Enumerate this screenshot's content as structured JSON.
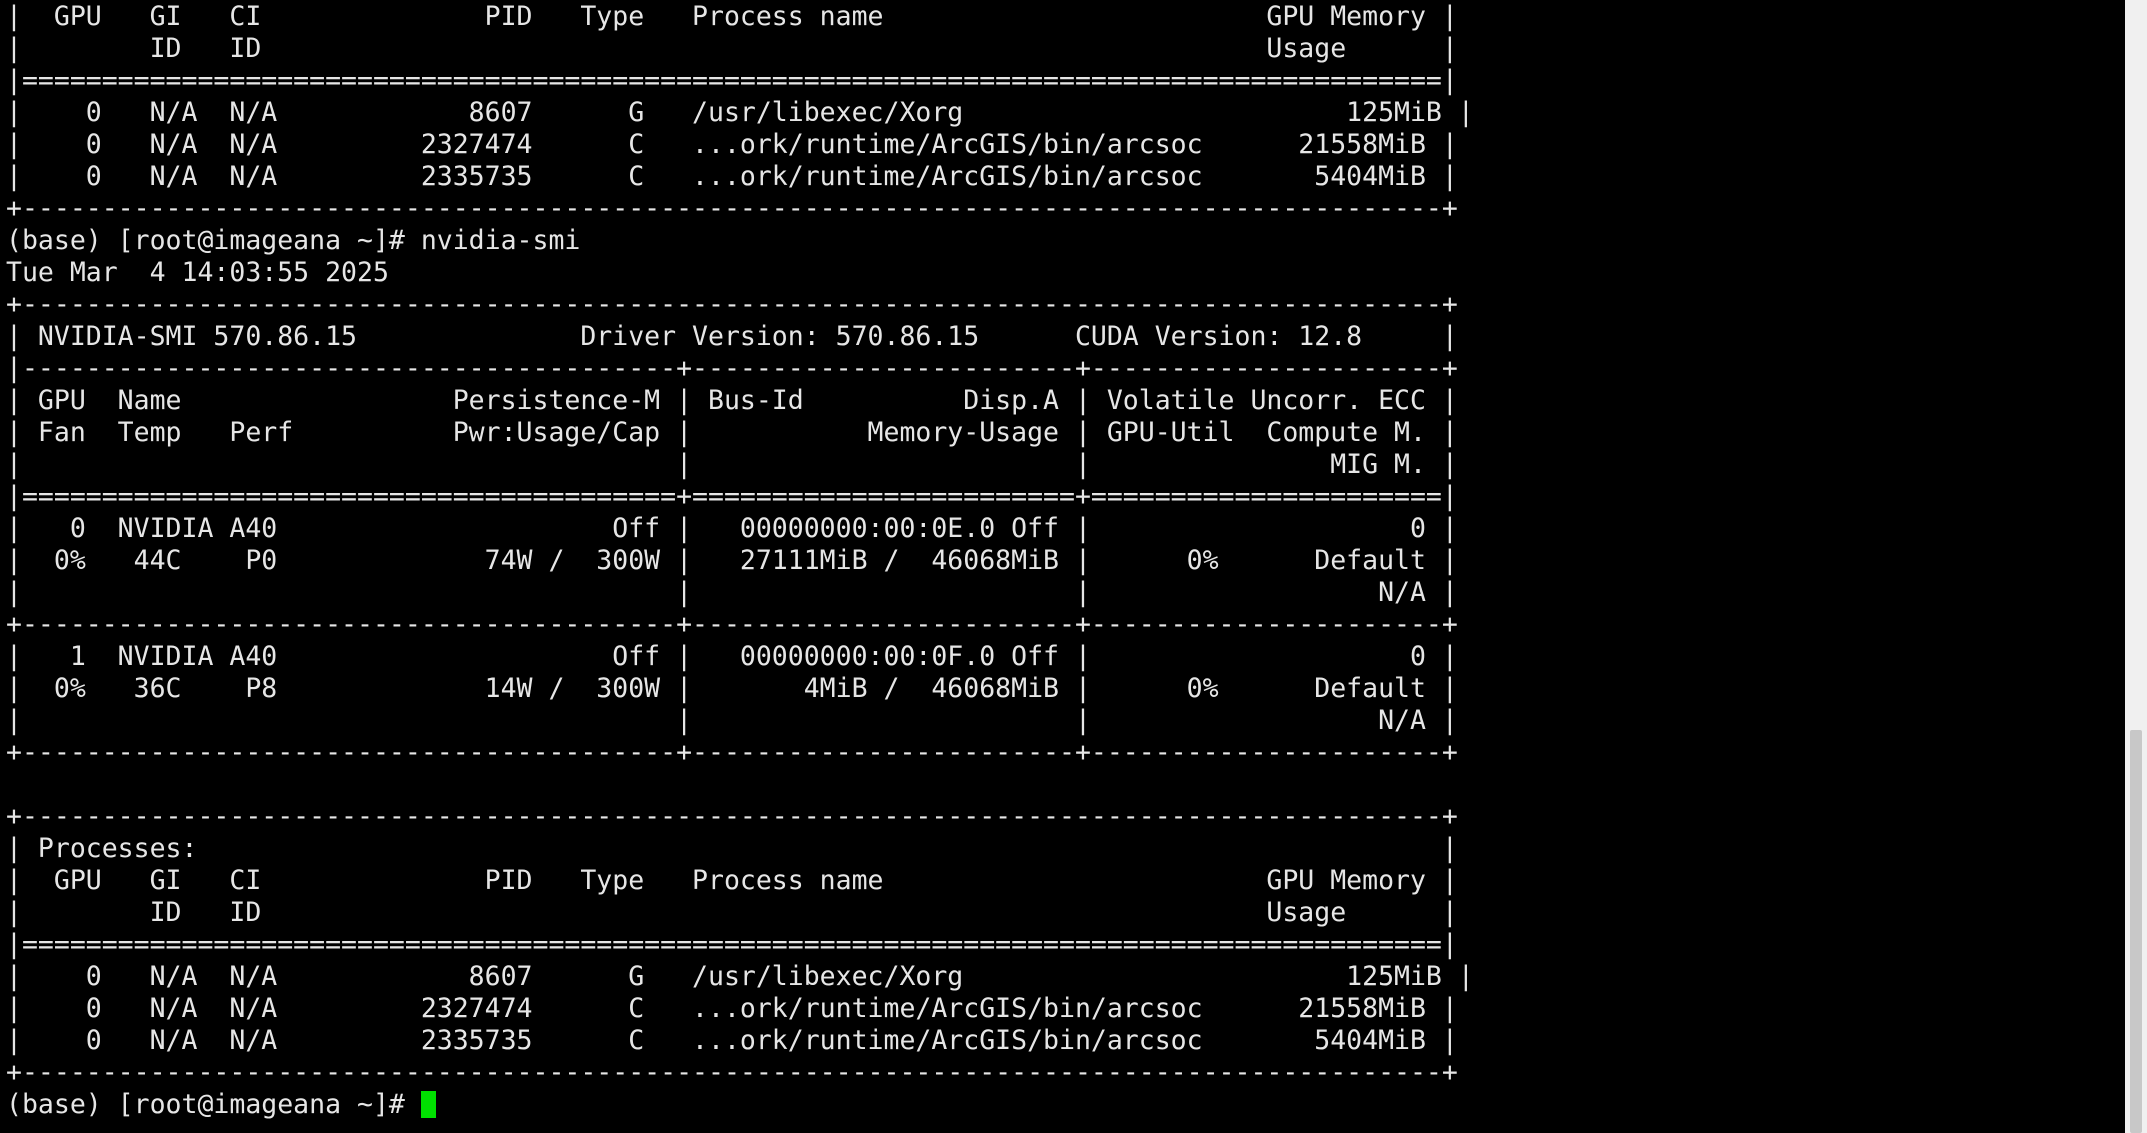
{
  "terminal": {
    "lines": [
      "|  GPU   GI   CI              PID   Type   Process name                        GPU Memory |",
      "|        ID   ID                                                               Usage      |",
      "|=========================================================================================|",
      "|    0   N/A  N/A            8607      G   /usr/libexec/Xorg                        125MiB |",
      "|    0   N/A  N/A         2327474      C   ...ork/runtime/ArcGIS/bin/arcsoc      21558MiB |",
      "|    0   N/A  N/A         2335735      C   ...ork/runtime/ArcGIS/bin/arcsoc       5404MiB |",
      "+-----------------------------------------------------------------------------------------+",
      "(base) [root@imageana ~]# nvidia-smi",
      "Tue Mar  4 14:03:55 2025",
      "+-----------------------------------------------------------------------------------------+",
      "| NVIDIA-SMI 570.86.15              Driver Version: 570.86.15      CUDA Version: 12.8     |",
      "|-----------------------------------------+------------------------+----------------------+",
      "| GPU  Name                 Persistence-M | Bus-Id          Disp.A | Volatile Uncorr. ECC |",
      "| Fan  Temp   Perf          Pwr:Usage/Cap |           Memory-Usage | GPU-Util  Compute M. |",
      "|                                         |                        |               MIG M. |",
      "|=========================================+========================+======================|",
      "|   0  NVIDIA A40                     Off |   00000000:00:0E.0 Off |                    0 |",
      "|  0%   44C    P0             74W /  300W |   27111MiB /  46068MiB |      0%      Default |",
      "|                                         |                        |                  N/A |",
      "+-----------------------------------------+------------------------+----------------------+",
      "|   1  NVIDIA A40                     Off |   00000000:00:0F.0 Off |                    0 |",
      "|  0%   36C    P8             14W /  300W |       4MiB /  46068MiB |      0%      Default |",
      "|                                         |                        |                  N/A |",
      "+-----------------------------------------+------------------------+----------------------+",
      "",
      "+-----------------------------------------------------------------------------------------+",
      "| Processes:                                                                              |",
      "|  GPU   GI   CI              PID   Type   Process name                        GPU Memory |",
      "|        ID   ID                                                               Usage      |",
      "|=========================================================================================|",
      "|    0   N/A  N/A            8607      G   /usr/libexec/Xorg                        125MiB |",
      "|    0   N/A  N/A         2327474      C   ...ork/runtime/ArcGIS/bin/arcsoc      21558MiB |",
      "|    0   N/A  N/A         2335735      C   ...ork/runtime/ArcGIS/bin/arcsoc       5404MiB |",
      "+-----------------------------------------------------------------------------------------+"
    ],
    "prompt": "(base) [root@imageana ~]# "
  },
  "colors": {
    "background": "#000000",
    "text": "#e6e6e6",
    "cursor": "#00e000",
    "scrollbar_track": "#f0f0f0",
    "scrollbar_thumb": "#c8c8c8"
  }
}
